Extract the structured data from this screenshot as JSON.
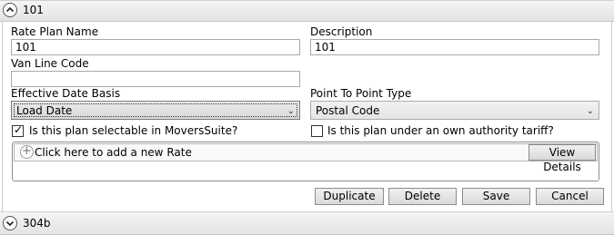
{
  "sections": [
    {
      "title": "101",
      "expanded": true
    },
    {
      "title": "304b",
      "expanded": false
    }
  ],
  "form": {
    "rate_plan_name_label": "Rate Plan Name",
    "rate_plan_name_value": "101",
    "description_label": "Description",
    "description_value": "101",
    "van_line_code_label": "Van Line Code",
    "van_line_code_value": "",
    "effective_date_basis_label": "Effective Date Basis",
    "effective_date_basis_value": "Load Date",
    "point_to_point_type_label": "Point To Point Type",
    "point_to_point_type_value": "Postal Code",
    "selectable_label": "Is this plan selectable in MoversSuite?",
    "selectable_checked": true,
    "own_authority_label": "Is this plan under an own authority tariff?",
    "own_authority_checked": false
  },
  "rates": {
    "add_label": "Click here to add a new Rate",
    "view_details_label": "View Details"
  },
  "actions": {
    "duplicate": "Duplicate",
    "delete": "Delete",
    "save": "Save",
    "cancel": "Cancel"
  }
}
